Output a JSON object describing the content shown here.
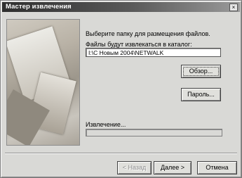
{
  "window": {
    "title": "Мастер извлечения",
    "close_glyph": "×"
  },
  "wizard": {
    "instruction": "Выберите папку для размещения файлов.",
    "path_label": "Файлы будут извлекаться в каталог:",
    "path_value": "I:\\C Новым 2004\\NETWALK",
    "browse_label": "Обзор...",
    "password_label": "Пароль...",
    "extract_label": "Извлечение...",
    "progress_percent": 0
  },
  "footer": {
    "back_label": "< Назад",
    "next_label": "Далее >",
    "cancel_label": "Отмена"
  },
  "icons": {
    "close": "close-icon"
  }
}
